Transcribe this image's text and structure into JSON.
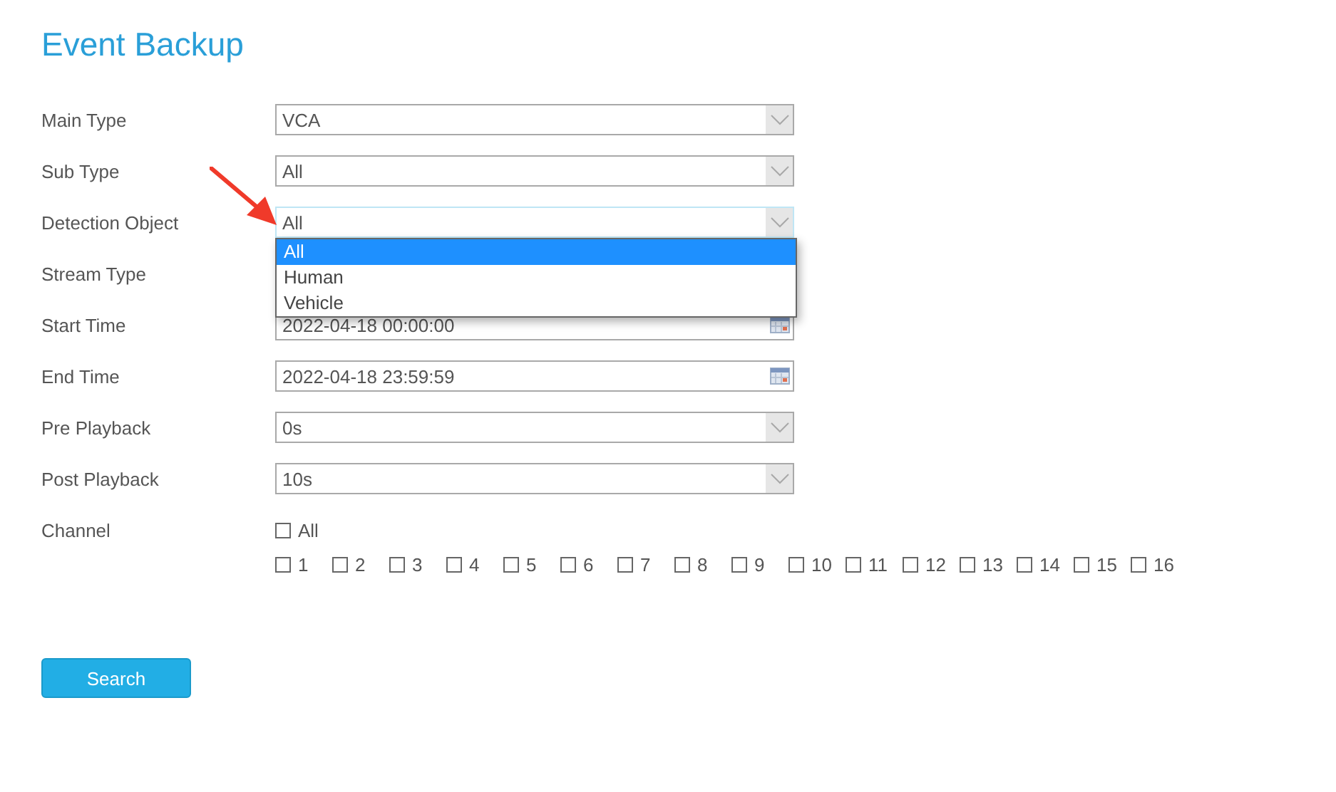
{
  "title": "Event Backup",
  "fields": [
    {
      "label": "Main Type",
      "kind": "select",
      "value": "VCA"
    },
    {
      "label": "Sub Type",
      "kind": "select",
      "value": "All"
    },
    {
      "label": "Detection Object",
      "kind": "select",
      "value": "All",
      "expanded": true,
      "options": [
        {
          "label": "All",
          "selected": true
        },
        {
          "label": "Human",
          "selected": false
        },
        {
          "label": "Vehicle",
          "selected": false
        }
      ]
    },
    {
      "label": "Stream Type",
      "kind": "hidden"
    },
    {
      "label": "Start Time",
      "kind": "date",
      "value": "2022-04-18 00:00:00"
    },
    {
      "label": "End Time",
      "kind": "date",
      "value": "2022-04-18 23:59:59"
    },
    {
      "label": "Pre Playback",
      "kind": "select",
      "value": "0s"
    },
    {
      "label": "Post Playback",
      "kind": "select",
      "value": "10s"
    }
  ],
  "channel": {
    "label": "Channel",
    "all": {
      "label": "All",
      "checked": false
    },
    "items": [
      {
        "label": "1",
        "checked": false
      },
      {
        "label": "2",
        "checked": false
      },
      {
        "label": "3",
        "checked": false
      },
      {
        "label": "4",
        "checked": false
      },
      {
        "label": "5",
        "checked": false
      },
      {
        "label": "6",
        "checked": false
      },
      {
        "label": "7",
        "checked": false
      },
      {
        "label": "8",
        "checked": false
      },
      {
        "label": "9",
        "checked": false
      },
      {
        "label": "10",
        "checked": false
      },
      {
        "label": "11",
        "checked": false
      },
      {
        "label": "12",
        "checked": false
      },
      {
        "label": "13",
        "checked": false
      },
      {
        "label": "14",
        "checked": false
      },
      {
        "label": "15",
        "checked": false
      },
      {
        "label": "16",
        "checked": false
      }
    ]
  },
  "search_button": "Search"
}
